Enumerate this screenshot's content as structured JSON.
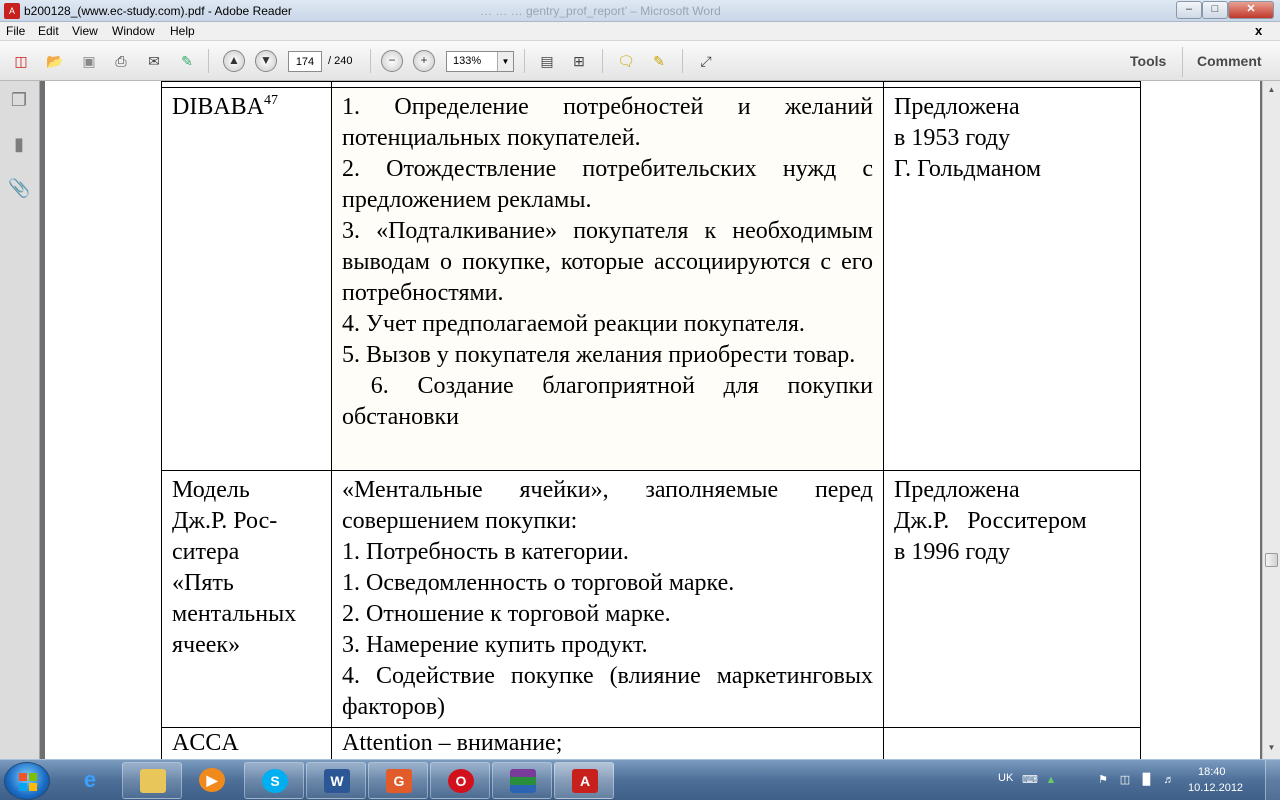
{
  "window": {
    "title": "b200128_(www.ec-study.com).pdf - Adobe Reader",
    "background_title": "… … … gentry_prof_report’ – Microsoft Word",
    "min": "–",
    "max": "□",
    "close": "✕",
    "doc_close": "x"
  },
  "menu": [
    "File",
    "Edit",
    "View",
    "Window",
    "Help"
  ],
  "toolbar": {
    "page_current": "174",
    "page_total": "/ 240",
    "zoom": "133%",
    "tools": "Tools",
    "comment": "Comment"
  },
  "document": {
    "rows": [
      {
        "col1": "DIBABA",
        "col1_sup": "47",
        "col2": [
          "1. Определение потребностей и желаний потенциальных покупателей.",
          "2. Отождествление потребительских нужд с предложением рекламы.",
          "3. «Подталкивание» покупателя к необходимым выводам о покупке, которые ассоциируются с его потребностями.",
          "4.  Учет предполагаемой реакции покупателя.",
          "5. Вызов у покупателя желания приобрести товар.",
          " 6. Создание благоприятной для покупки обстановки"
        ],
        "col3": [
          "Предложена",
          "в 1953 году",
          "Г. Гольдманом"
        ]
      },
      {
        "col1": [
          "Модель",
          "Дж.Р. Рос-",
          "ситера",
          "«Пять",
          "ментальных",
          "ячеек»"
        ],
        "col2": [
          "«Ментальные ячейки», заполняемые перед совершением покупки:",
          "1.  Потребность в категории.",
          "1.  Осведомленность о торговой марке.",
          "2.  Отношение к торговой марке.",
          "3.  Намерение купить продукт.",
          "4. Содействие покупке (влияние маркетинговых факторов)"
        ],
        "col3": [
          "Предложена",
          "Дж.Р.   Росситером",
          "в 1996 году"
        ]
      },
      {
        "col1": "ACCA",
        "col2": "Attention – внимание;",
        "col3": ""
      }
    ]
  },
  "taskbar": {
    "lang": "UK",
    "time": "18:40",
    "date": "10.12.2012",
    "apps": [
      "ie",
      "explorer",
      "media-player",
      "skype",
      "word",
      "foxit",
      "opera",
      "winrar",
      "adobe-reader"
    ]
  }
}
